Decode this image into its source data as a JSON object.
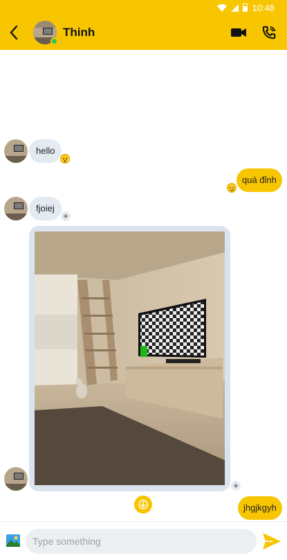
{
  "status_bar": {
    "time": "10:48",
    "icons": [
      "wifi-icon",
      "signal-icon",
      "battery-icon"
    ]
  },
  "header": {
    "contact_name": "Thinh",
    "online": true,
    "actions": [
      "video-call-icon",
      "phone-call-icon"
    ]
  },
  "messages": [
    {
      "direction": "incoming",
      "text": "hello",
      "reaction": "surprised-emoji"
    },
    {
      "direction": "outgoing",
      "text": "quá đỉnh",
      "reaction": "smirk-emoji"
    },
    {
      "direction": "incoming",
      "text": "fjoiej",
      "reaction_add": "+"
    },
    {
      "direction": "incoming",
      "type": "image",
      "image_desc_icon": "room-photo",
      "reaction_add": "+"
    },
    {
      "direction": "outgoing",
      "text": "jhgjkgyh"
    }
  ],
  "composer": {
    "placeholder": "Type something"
  },
  "colors": {
    "accent": "#f7c600",
    "incoming_bubble": "#e3eaf1",
    "online": "#22c55e"
  }
}
